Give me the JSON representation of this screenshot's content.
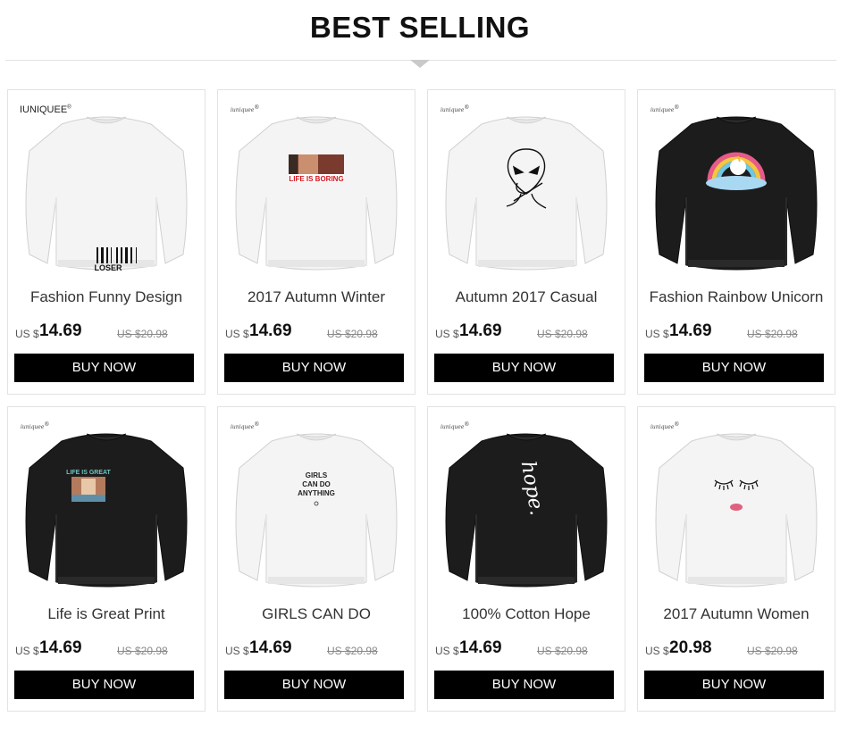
{
  "page_title": "BEST SELLING",
  "currency_prefix": "US $",
  "buy_label": "BUY NOW",
  "colors": {
    "button_bg": "#000000",
    "button_text": "#ffffff",
    "sweater_white": "#f4f4f4",
    "sweater_black": "#1c1c1c"
  },
  "products": [
    {
      "brand": "IUNIQUEE",
      "sweater": "white",
      "print": "barcode-loser",
      "print_text": "LOSER",
      "title": "Fashion Funny Design",
      "price": "14.69",
      "old_price": "US $20.98"
    },
    {
      "brand": "iuniquee",
      "sweater": "white",
      "print": "photo-life-is-boring",
      "print_text": "LIFE IS BORING",
      "title": "2017 Autumn Winter",
      "price": "14.69",
      "old_price": "US $20.98"
    },
    {
      "brand": "iuniquee",
      "sweater": "white",
      "print": "alien-line-art",
      "print_text": "",
      "title": "Autumn 2017 Casual",
      "price": "14.69",
      "old_price": "US $20.98"
    },
    {
      "brand": "iuniquee",
      "sweater": "black",
      "print": "rainbow-unicorn",
      "print_text": "",
      "title": "Fashion Rainbow Unicorn",
      "price": "14.69",
      "old_price": "US $20.98"
    },
    {
      "brand": "iuniquee",
      "sweater": "black",
      "print": "photo-life-is-great",
      "print_text": "LIFE IS GREAT",
      "title": "Life is Great Print",
      "price": "14.69",
      "old_price": "US $20.98"
    },
    {
      "brand": "iuniquee",
      "sweater": "white",
      "print": "girls-can-do-anything",
      "print_text": "GIRLS CAN DO ANYTHING",
      "title": "GIRLS CAN DO",
      "price": "14.69",
      "old_price": "US $20.98"
    },
    {
      "brand": "iuniquee",
      "sweater": "black",
      "print": "hope-script",
      "print_text": "hope.",
      "title": "100% Cotton Hope",
      "price": "14.69",
      "old_price": "US $20.98"
    },
    {
      "brand": "iuniquee",
      "sweater": "white",
      "print": "lashes-lips",
      "print_text": "",
      "title": "2017 Autumn Women",
      "price": "20.98",
      "old_price": "US $20.98"
    }
  ]
}
